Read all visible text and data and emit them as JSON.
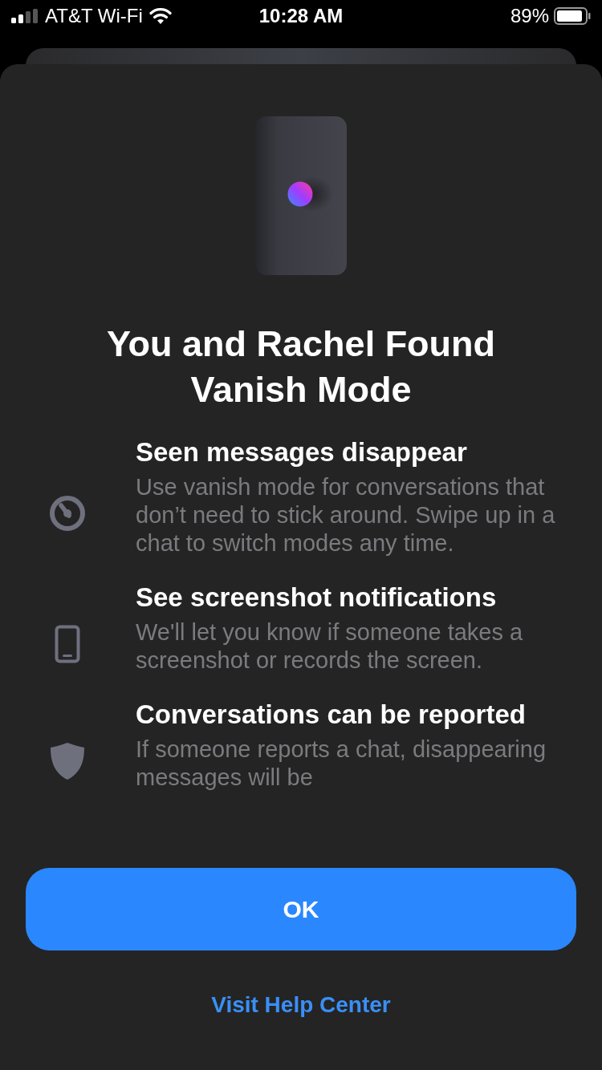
{
  "status_bar": {
    "carrier": "AT&T Wi-Fi",
    "time": "10:28 AM",
    "battery": "89%"
  },
  "sheet": {
    "title": "You and Rachel Found Vanish Mode",
    "features": [
      {
        "kind": "timer",
        "title": "Seen messages disappear",
        "body": "Use vanish mode for conversations that don’t need to stick around. Swipe up in a chat to switch modes any time."
      },
      {
        "kind": "phone",
        "title": "See screenshot notifications",
        "body": "We'll let you know if someone takes a screenshot or records the screen."
      },
      {
        "kind": "shield",
        "title": "Conversations can be reported",
        "body": "If someone reports a chat, disappearing messages will be"
      }
    ],
    "primary_button": "OK",
    "link": "Visit Help Center"
  }
}
